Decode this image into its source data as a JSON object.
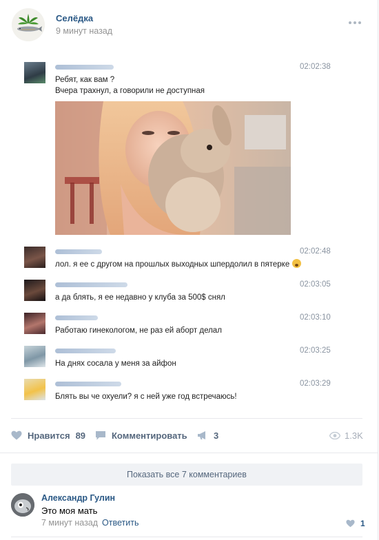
{
  "post": {
    "group_name": "Селёдка",
    "time": "9 минут назад"
  },
  "chat": {
    "messages": [
      {
        "time": "02:02:38",
        "lines": [
          "Ребят, как вам ?",
          "Вчера трахнул, а говорили не доступная"
        ]
      },
      {
        "time": "02:02:48",
        "lines": [
          "лол. я ее с другом на прошлых выходных шпердолил в пятерке"
        ]
      },
      {
        "time": "02:03:05",
        "lines": [
          "а да блять, я ее недавно у клуба за 500$ снял"
        ]
      },
      {
        "time": "02:03:10",
        "lines": [
          "Работаю гинекологом, не раз ей аборт делал"
        ]
      },
      {
        "time": "02:03:25",
        "lines": [
          "На днях сосала у меня за айфон"
        ]
      },
      {
        "time": "02:03:29",
        "lines": [
          "Блять вы че охуели? я с ней уже год встречаюсь!"
        ]
      }
    ]
  },
  "actions": {
    "like_label": "Нравится",
    "like_count": "89",
    "comment_label": "Комментировать",
    "share_count": "3",
    "views": "1.3K"
  },
  "comments": {
    "show_all": "Показать все 7 комментариев",
    "items": [
      {
        "author": "Александр Гулин",
        "text": "Это моя мать",
        "time": "7 минут назад",
        "reply": "Ответить",
        "likes": "1"
      }
    ]
  },
  "colors": {
    "link": "#2a5885",
    "muted": "#939393",
    "action": "#55677d",
    "divider": "#e7e8ec"
  }
}
